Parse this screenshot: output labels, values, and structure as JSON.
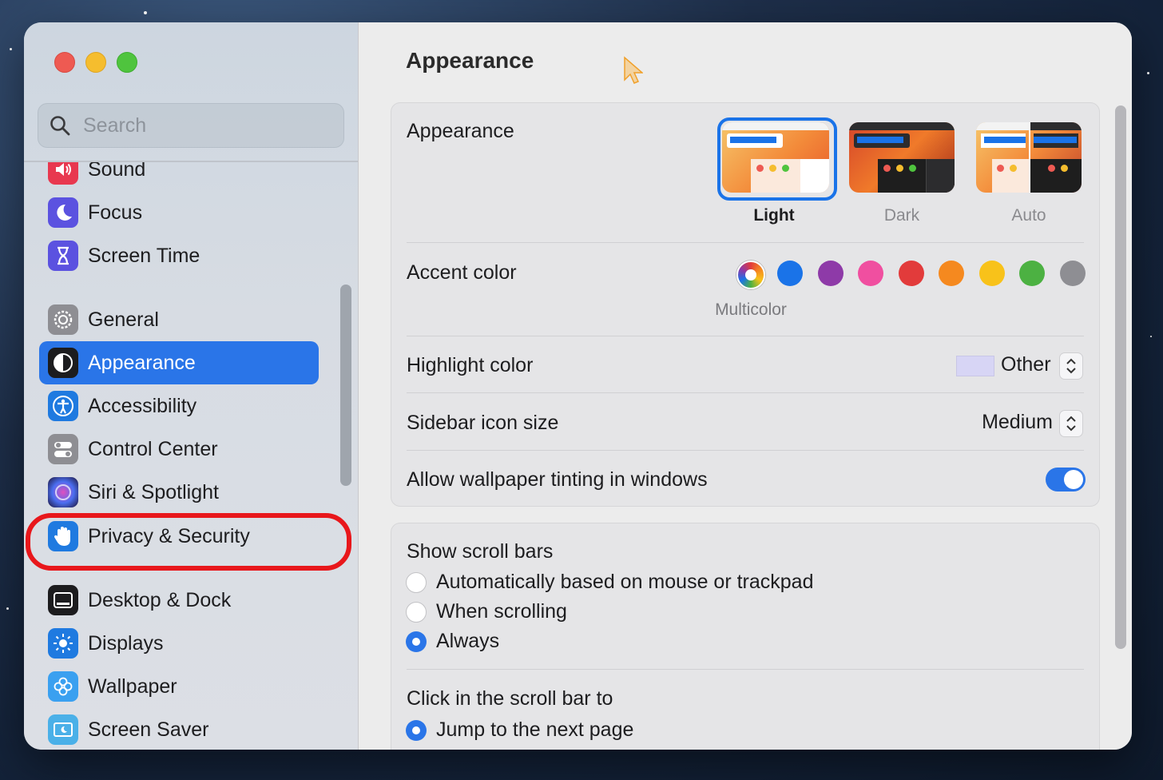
{
  "window": {
    "title": "Appearance"
  },
  "search": {
    "placeholder": "Search"
  },
  "sidebar": {
    "items": [
      {
        "label": "Sound",
        "icon": "speaker-icon",
        "color": "#e8384f"
      },
      {
        "label": "Focus",
        "icon": "moon-icon",
        "color": "#5b52e0"
      },
      {
        "label": "Screen Time",
        "icon": "hourglass-icon",
        "color": "#5b52e0"
      },
      {
        "label": "General",
        "icon": "gear-icon",
        "color": "#8e8e93"
      },
      {
        "label": "Appearance",
        "icon": "appearance-icon",
        "color": "#1c1c1e",
        "selected": true
      },
      {
        "label": "Accessibility",
        "icon": "accessibility-icon",
        "color": "#1f7ae0"
      },
      {
        "label": "Control Center",
        "icon": "toggles-icon",
        "color": "#8e8e93"
      },
      {
        "label": "Siri & Spotlight",
        "icon": "siri-icon",
        "color": "#3a1f6e"
      },
      {
        "label": "Privacy & Security",
        "icon": "hand-icon",
        "color": "#1f7ae0"
      },
      {
        "label": "Desktop & Dock",
        "icon": "dock-icon",
        "color": "#1c1c1e"
      },
      {
        "label": "Displays",
        "icon": "sun-icon",
        "color": "#1f7ae0"
      },
      {
        "label": "Wallpaper",
        "icon": "flower-icon",
        "color": "#3aa0f0"
      },
      {
        "label": "Screen Saver",
        "icon": "screensaver-icon",
        "color": "#4ab0e8"
      }
    ]
  },
  "appearance": {
    "label": "Appearance",
    "options": [
      {
        "label": "Light",
        "selected": true
      },
      {
        "label": "Dark",
        "selected": false
      },
      {
        "label": "Auto",
        "selected": false
      }
    ]
  },
  "accent": {
    "label": "Accent color",
    "selected_caption": "Multicolor",
    "colors": [
      "multicolor",
      "#1a73e8",
      "#8e3aa8",
      "#f04fa0",
      "#e23b3b",
      "#f5891f",
      "#f8c21a",
      "#4cb142",
      "#8e8e93"
    ]
  },
  "highlight": {
    "label": "Highlight color",
    "value": "Other",
    "swatch": "#d7d5f5"
  },
  "icon_size": {
    "label": "Sidebar icon size",
    "value": "Medium"
  },
  "tinting": {
    "label": "Allow wallpaper tinting in windows",
    "enabled": true
  },
  "scrollbars": {
    "label": "Show scroll bars",
    "options": [
      {
        "label": "Automatically based on mouse or trackpad",
        "selected": false
      },
      {
        "label": "When scrolling",
        "selected": false
      },
      {
        "label": "Always",
        "selected": true
      }
    ]
  },
  "click_scroll": {
    "label": "Click in the scroll bar to",
    "options": [
      {
        "label": "Jump to the next page",
        "selected": true
      }
    ]
  },
  "colors": {
    "accent": "#2a75e8",
    "annotation": "#e8171b"
  }
}
